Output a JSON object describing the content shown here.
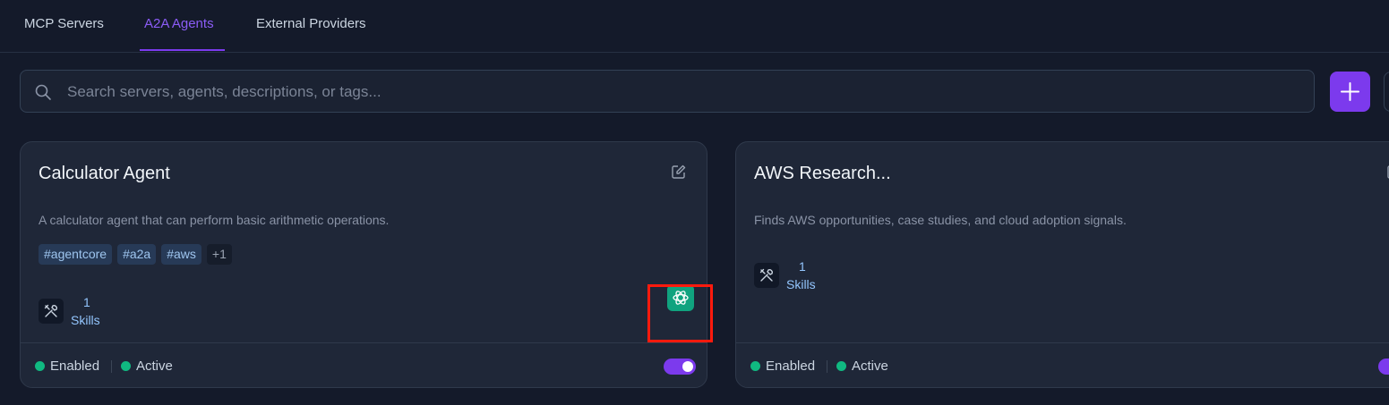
{
  "tabs": [
    {
      "label": "MCP Servers",
      "active": false
    },
    {
      "label": "A2A Agents",
      "active": true
    },
    {
      "label": "External Providers",
      "active": false
    }
  ],
  "search": {
    "placeholder": "Search servers, agents, descriptions, or tags...",
    "value": ""
  },
  "icons": {
    "search": "search-icon",
    "add": "plus-icon",
    "edit": "edit-icon",
    "skills": "tools-icon",
    "agent": "openai-icon"
  },
  "colors": {
    "accent": "#7c3aed",
    "status_green": "#10b981",
    "agent_badge": "#10a37f",
    "highlight": "#ff1a0d"
  },
  "cards": [
    {
      "title": "Calculator Agent",
      "description": "A calculator agent that can perform basic arithmetic operations.",
      "tags": [
        "#agentcore",
        "#a2a",
        "#aws"
      ],
      "more_tags": "+1",
      "skills_count": "1",
      "skills_label": "Skills",
      "status_enabled": "Enabled",
      "status_active": "Active",
      "toggle_on": true
    },
    {
      "title": "AWS Research...",
      "description": "Finds AWS opportunities, case studies, and cloud adoption signals.",
      "tags": [],
      "skills_count": "1",
      "skills_label": "Skills",
      "status_enabled": "Enabled",
      "status_active": "Active",
      "toggle_on": true
    }
  ]
}
